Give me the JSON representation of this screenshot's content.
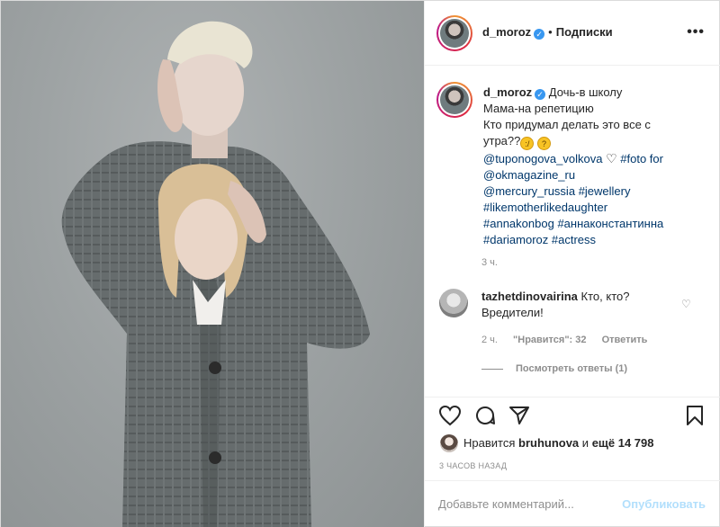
{
  "header": {
    "username": "d_moroz",
    "separator": "•",
    "follow_label": "Подписки",
    "more_icon": "more-horizontal-icon"
  },
  "caption": {
    "username": "d_moroz",
    "line1": "Дочь-в школу",
    "line2": "Мама-на репетицию",
    "line3": "Кто придумал делать это все с",
    "line4_text": "утра??",
    "mention1": "@tuponogova_volkova",
    "tag_foto": "#foto for",
    "mention2": "@okmagazine_ru",
    "mention3": "@mercury_russia",
    "tag_jewellery": "#jewellery",
    "tag_like": "#likemotherlikedaughter",
    "tag_anna": "#annakonbog",
    "tag_anna_ru": "#аннаконстантинна",
    "tag_daria": "#dariamoroz",
    "tag_actress": "#actress",
    "time": "3 ч."
  },
  "comment": {
    "username": "tazhetdinovairina",
    "text1": "Кто, кто?",
    "text2": "Вредители!",
    "time": "2 ч.",
    "likes": "\"Нравится\": 32",
    "reply": "Ответить",
    "view_replies": "Посмотреть ответы (1)"
  },
  "likes": {
    "prefix": "Нравится",
    "user": "bruhunova",
    "middle": "и",
    "count": "ещё 14 798"
  },
  "posted": "3 ЧАСОВ НАЗАД",
  "add_comment": {
    "placeholder": "Добавьте комментарий...",
    "publish": "Опубликовать"
  },
  "colors": {
    "link": "#00376b",
    "muted": "#8e8e8e",
    "verified": "#3897f0",
    "publish_disabled": "#b2dffc"
  }
}
